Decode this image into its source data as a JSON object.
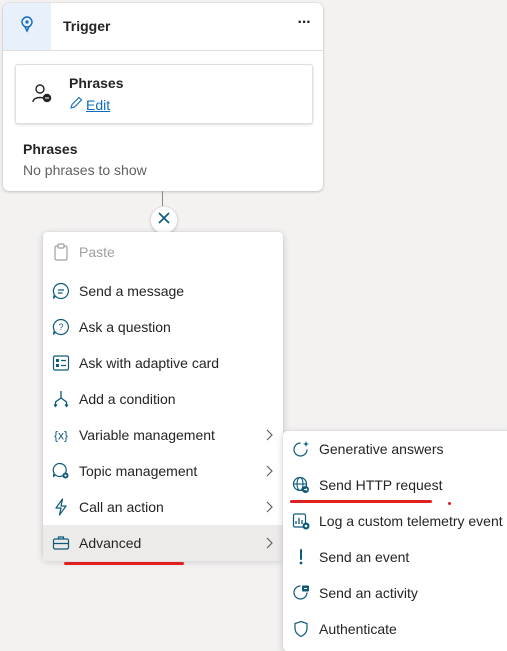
{
  "card": {
    "title": "Trigger",
    "more_label": "···",
    "phrases_box_title": "Phrases",
    "edit_label": "Edit",
    "section_heading": "Phrases",
    "empty_text": "No phrases to show"
  },
  "menu": {
    "items": [
      {
        "label": "Paste",
        "icon": "paste-icon",
        "disabled": true
      },
      {
        "label": "Send a message",
        "icon": "message-icon"
      },
      {
        "label": "Ask a question",
        "icon": "question-icon"
      },
      {
        "label": "Ask with adaptive card",
        "icon": "adaptive-card-icon"
      },
      {
        "label": "Add a condition",
        "icon": "condition-branch-icon"
      },
      {
        "label": "Variable management",
        "icon": "variable-icon",
        "submenu": true
      },
      {
        "label": "Topic management",
        "icon": "topic-icon",
        "submenu": true
      },
      {
        "label": "Call an action",
        "icon": "lightning-icon",
        "submenu": true
      },
      {
        "label": "Advanced",
        "icon": "toolbox-icon",
        "submenu": true,
        "selected": true
      }
    ]
  },
  "submenu": {
    "items": [
      {
        "label": "Generative answers",
        "icon": "sparkle-chat-icon"
      },
      {
        "label": "Send HTTP request",
        "icon": "globe-icon"
      },
      {
        "label": "Log a custom telemetry event",
        "icon": "telemetry-icon"
      },
      {
        "label": "Send an event",
        "icon": "exclamation-icon"
      },
      {
        "label": "Send an activity",
        "icon": "activity-icon"
      },
      {
        "label": "Authenticate",
        "icon": "shield-icon"
      }
    ]
  },
  "colors": {
    "accent": "#0f6cbd",
    "annotation": "#e02020",
    "icon": "#0e5a7a"
  }
}
